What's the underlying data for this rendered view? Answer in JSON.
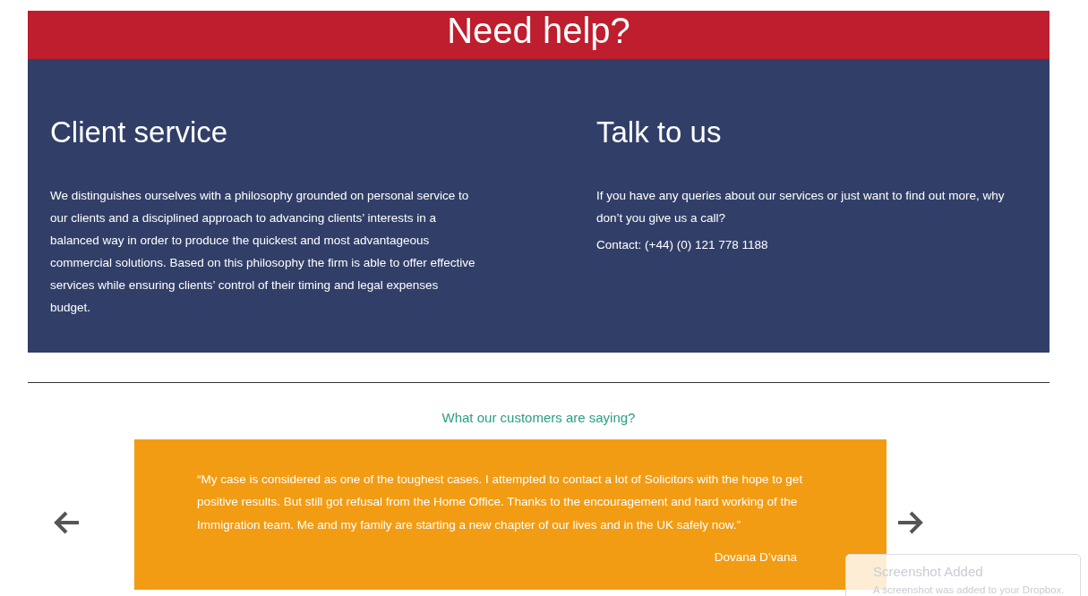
{
  "banner": {
    "title": "Need help?"
  },
  "columns": [
    {
      "heading": "Client service",
      "paragraphs": [
        "We distinguishes ourselves with a philosophy grounded on personal service to our clients and a disciplined approach to advancing clients’ interests in a balanced way in order to produce the quickest and most advantageous commercial solutions. Based on this philosophy the firm is able to offer effective services while ensuring clients’ control of their timing and legal expenses budget."
      ]
    },
    {
      "heading": "Talk to us",
      "paragraphs": [
        "If you have any queries about our services or just want to find out more, why don’t you give us a call?",
        "Contact: (+44) (0) 121 778 1188"
      ]
    }
  ],
  "testimonials": {
    "heading": "What our customers are saying?",
    "quote": "“My case is considered as one of the toughest cases. I attempted to contact a lot of Solicitors with the hope to get positive results. But still got refusal from the Home Office. Thanks to the encouragement and hard working of the Immigration team. Me and my family are starting a new chapter of our lives and in the UK safely now.”",
    "author": "Dovana D’vana"
  },
  "notification": {
    "title": "Screenshot Added",
    "message": "A screenshot was added to your Dropbox."
  }
}
